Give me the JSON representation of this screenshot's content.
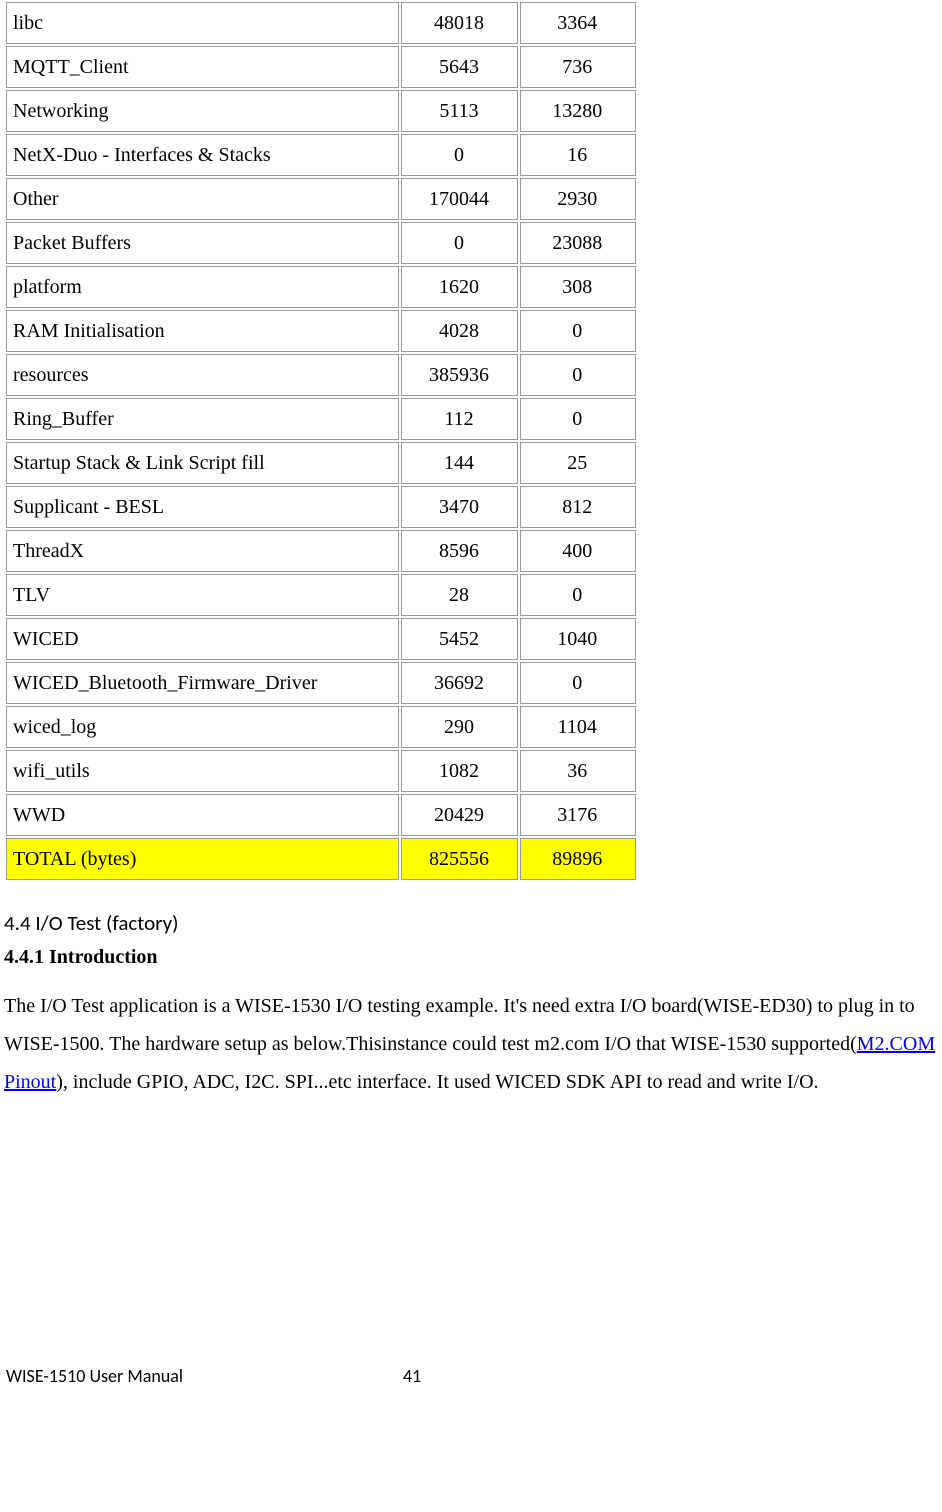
{
  "table": {
    "rows": [
      {
        "name": "libc",
        "a": "48018",
        "b": "3364"
      },
      {
        "name": "MQTT_Client",
        "a": "5643",
        "b": "736"
      },
      {
        "name": "Networking",
        "a": "5113",
        "b": "13280"
      },
      {
        "name": "NetX-Duo - Interfaces & Stacks",
        "a": "0",
        "b": "16"
      },
      {
        "name": "Other",
        "a": "170044",
        "b": "2930"
      },
      {
        "name": "Packet Buffers",
        "a": "0",
        "b": "23088"
      },
      {
        "name": "platform",
        "a": "1620",
        "b": "308"
      },
      {
        "name": "RAM Initialisation",
        "a": "4028",
        "b": "0"
      },
      {
        "name": "resources",
        "a": "385936",
        "b": "0"
      },
      {
        "name": "Ring_Buffer",
        "a": "112",
        "b": "0"
      },
      {
        "name": "Startup Stack & Link Script fill",
        "a": "144",
        "b": "25"
      },
      {
        "name": "Supplicant - BESL",
        "a": "3470",
        "b": "812"
      },
      {
        "name": "ThreadX",
        "a": "8596",
        "b": "400"
      },
      {
        "name": "TLV",
        "a": "28",
        "b": "0"
      },
      {
        "name": "WICED",
        "a": "5452",
        "b": "1040"
      },
      {
        "name": "WICED_Bluetooth_Firmware_Driver",
        "a": "36692",
        "b": "0"
      },
      {
        "name": "wiced_log",
        "a": "290",
        "b": "1104"
      },
      {
        "name": "wifi_utils",
        "a": "1082",
        "b": "36"
      },
      {
        "name": "WWD",
        "a": "20429",
        "b": "3176"
      }
    ],
    "total": {
      "name": "TOTAL (bytes)",
      "a": "825556",
      "b": "89896"
    }
  },
  "section": {
    "heading": "4.4 I/O Test (factory)",
    "subheading": "4.4.1 Introduction",
    "para_pre": "The I/O Test application is a WISE-1530 I/O testing example. It's need extra I/O board(WISE-ED30) to plug in to WISE-1500. The hardware setup as below.Thisinstance could test m2.com I/O that WISE-1530 supported(",
    "link_text": "M2.COM Pinout",
    "para_post": "), include GPIO, ADC, I2C. SPI...etc interface. It used WICED SDK API to read and write I/O."
  },
  "footer": {
    "left": "WISE-1510 User Manual",
    "page": "41"
  }
}
